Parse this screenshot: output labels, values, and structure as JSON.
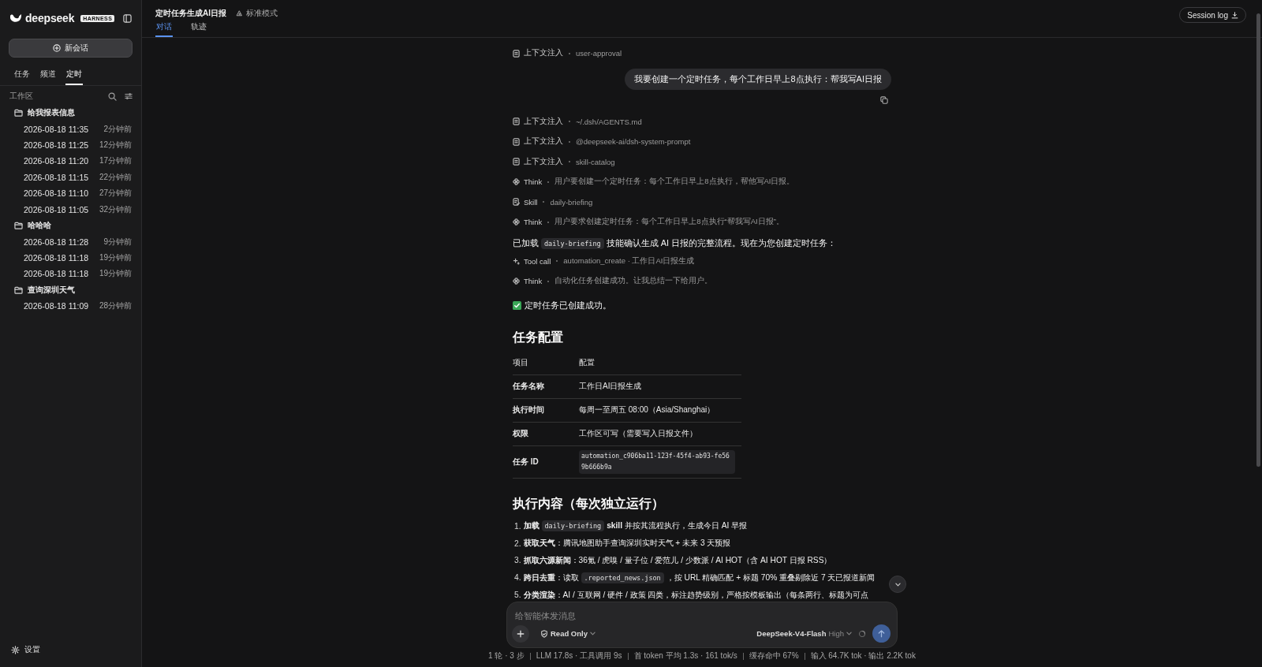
{
  "sidebar": {
    "logo": "deepseek",
    "badge": "HARNESS",
    "new_chat": "新会话",
    "tabs": [
      {
        "label": "任务",
        "selected": false
      },
      {
        "label": "频道",
        "selected": false
      },
      {
        "label": "定时",
        "selected": true
      }
    ],
    "section_label": "工作区",
    "groups": [
      {
        "name": "给我报表信息",
        "children": [
          {
            "title": "2026-08-18 11:35",
            "time": "2分钟前"
          },
          {
            "title": "2026-08-18 11:25",
            "time": "12分钟前"
          },
          {
            "title": "2026-08-18 11:20",
            "time": "17分钟前"
          },
          {
            "title": "2026-08-18 11:15",
            "time": "22分钟前"
          },
          {
            "title": "2026-08-18 11:10",
            "time": "27分钟前"
          },
          {
            "title": "2026-08-18 11:05",
            "time": "32分钟前"
          }
        ]
      },
      {
        "name": "哈哈哈",
        "children": [
          {
            "title": "2026-08-18 11:28",
            "time": "9分钟前"
          },
          {
            "title": "2026-08-18 11:18",
            "time": "19分钟前"
          },
          {
            "title": "2026-08-18 11:18",
            "time": "19分钟前"
          }
        ]
      },
      {
        "name": "查询深圳天气",
        "children": [
          {
            "title": "2026-08-18 11:09",
            "time": "28分钟前"
          }
        ]
      }
    ],
    "settings": "设置"
  },
  "header": {
    "title": "定时任务生成AI日报",
    "mode": "标准模式",
    "tabs": [
      {
        "label": "对话",
        "selected": true
      },
      {
        "label": "轨迹",
        "selected": false
      }
    ],
    "session_log": "Session log"
  },
  "messages": [
    {
      "kind": "context",
      "label": "上下文注入",
      "detail": "user-approval"
    },
    {
      "kind": "user",
      "text": "我要创建一个定时任务，每个工作日早上8点执行：帮我写AI日报"
    },
    {
      "kind": "context",
      "label": "上下文注入",
      "detail": "~/.dsh/AGENTS.md"
    },
    {
      "kind": "context",
      "label": "上下文注入",
      "detail": "@deepseek-ai/dsh-system-prompt"
    },
    {
      "kind": "context",
      "label": "上下文注入",
      "detail": "skill-catalog"
    },
    {
      "kind": "think",
      "label": "Think",
      "detail": "用户要创建一个定时任务：每个工作日早上8点执行，帮他写AI日报。"
    },
    {
      "kind": "skill",
      "label": "Skill",
      "detail": "daily-briefing"
    },
    {
      "kind": "think",
      "label": "Think",
      "detail": "用户要求创建定时任务：每个工作日早上8点执行“帮我写AI日报”。"
    },
    {
      "kind": "paragraph",
      "parts": [
        {
          "text": "已加载"
        },
        {
          "code": "daily-briefing"
        },
        {
          "text": "技能确认生成 AI 日报的完整流程。现在为您创建定时任务："
        }
      ]
    },
    {
      "kind": "tool",
      "label": "Tool call",
      "detail": "automation_create · 工作日AI日报生成"
    },
    {
      "kind": "think",
      "label": "Think",
      "detail": "自动化任务创建成功。让我总结一下给用户。"
    },
    {
      "kind": "success",
      "text": "定时任务已创建成功。"
    },
    {
      "kind": "heading",
      "text": "任务配置"
    },
    {
      "kind": "table",
      "columns": [
        "项目",
        "配置"
      ],
      "rows": [
        {
          "label": "任务名称",
          "value": "工作日AI日报生成",
          "kind": "text"
        },
        {
          "label": "执行时间",
          "value": "每周一至周五 08:00（Asia/Shanghai）",
          "kind": "text"
        },
        {
          "label": "权限",
          "value": "工作区可写（需要写入日报文件）",
          "kind": "text"
        },
        {
          "label": "任务 ID",
          "value": "automation_c906ba11-123f-45f4-ab93-fe569b666b9a",
          "kind": "code"
        }
      ]
    },
    {
      "kind": "heading",
      "text": "执行内容（每次独立运行）"
    },
    {
      "kind": "list",
      "items": [
        {
          "number": "1.",
          "parts": [
            {
              "text": "**加载**"
            },
            {
              "code": "daily-briefing"
            },
            {
              "text": "**skill** 并按其流程执行，生成今日 AI 早报"
            }
          ]
        },
        {
          "number": "2.",
          "parts": [
            {
              "text": "**获取天气**：腾讯地图助手查询深圳实时天气 + 未来 3 天预报"
            }
          ]
        },
        {
          "number": "3.",
          "parts": [
            {
              "text": "**抓取六源新闻**：36氪 / 虎嗅 / 量子位 / 爱范儿 / 少数派 / AI HOT（含 AI HOT 日报 RSS）"
            }
          ]
        },
        {
          "number": "4.",
          "parts": [
            {
              "text": "**跨日去重**：读取"
            },
            {
              "code": ".reported_news.json"
            },
            {
              "text": "，按 URL 精确匹配 + 标题 70% 重叠剔除近 7 天已报道新闻"
            }
          ]
        },
        {
          "number": "5.",
          "parts": [
            {
              "text": "**分类渲染**：AI / 互联网 / 硬件 / 政策 四类，标注趋势级别，严格按模板输出（每条两行、标题为可点"
            }
          ]
        }
      ]
    }
  ],
  "composer": {
    "placeholder": "给智能体发消息",
    "mode": "Read Only",
    "model": "DeepSeek-V4-Flash",
    "effort": "High"
  },
  "stats": [
    "1 轮 · 3 步",
    "LLM 17.8s · 工具调用 9s",
    "首 token 平均 1.3s · 161 tok/s",
    "缓存命中 67%",
    "输入 64.7K tok · 输出 2.2K tok"
  ]
}
